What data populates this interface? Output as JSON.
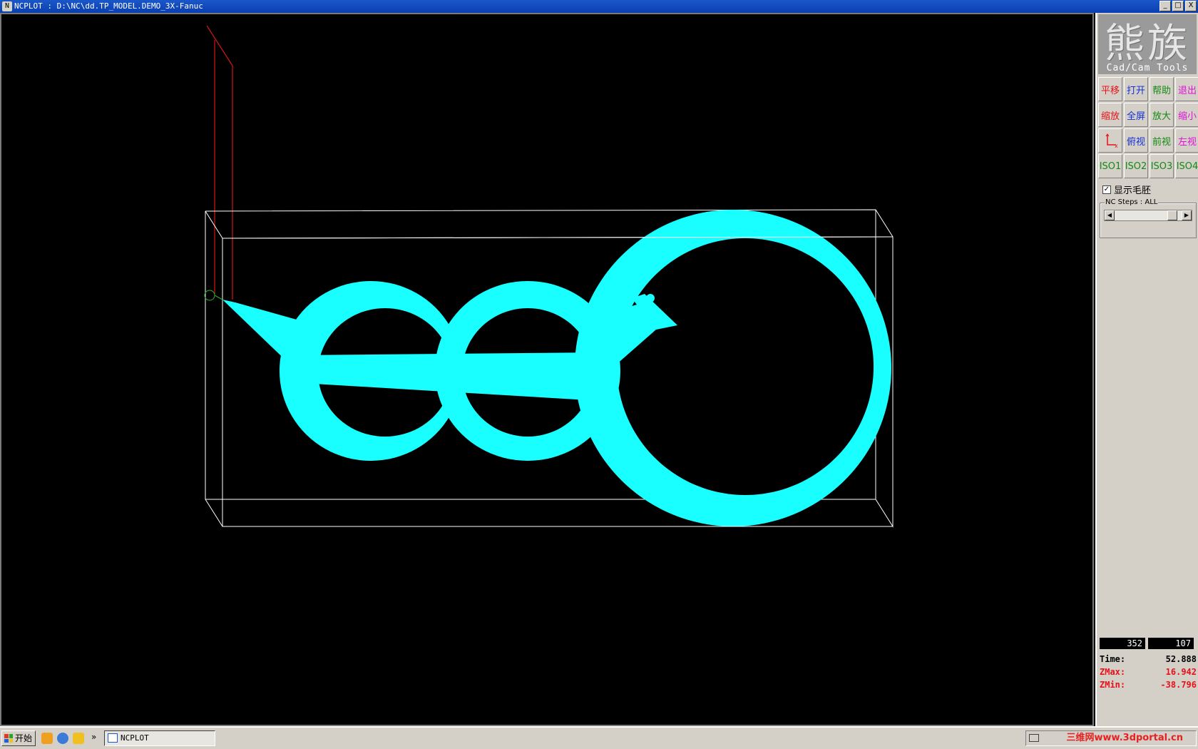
{
  "window": {
    "title": "NCPLOT : D:\\NC\\dd.TP_MODEL.DEMO_3X-Fanuc",
    "app_icon": "N",
    "controls": [
      "_",
      "□",
      "X"
    ]
  },
  "logo": {
    "chars": "熊族",
    "subtitle": "Cad/Cam Tools"
  },
  "toolbar": {
    "buttons": [
      {
        "label": "平移",
        "color": "#e8101a"
      },
      {
        "label": "打开",
        "color": "#1530d8"
      },
      {
        "label": "帮助",
        "color": "#118a11"
      },
      {
        "label": "退出",
        "color": "#e011d8"
      },
      {
        "label": "缩放",
        "color": "#e8101a"
      },
      {
        "label": "全屏",
        "color": "#1530d8"
      },
      {
        "label": "放大",
        "color": "#118a11"
      },
      {
        "label": "缩小",
        "color": "#e011d8"
      },
      {
        "label": "",
        "icon": "axis-icon",
        "color": "#e8101a"
      },
      {
        "label": "俯视",
        "color": "#1530d8"
      },
      {
        "label": "前视",
        "color": "#118a11"
      },
      {
        "label": "左视",
        "color": "#e011d8"
      },
      {
        "label": "ISO1",
        "color": "#118a11"
      },
      {
        "label": "ISO2",
        "color": "#118a11"
      },
      {
        "label": "ISO3",
        "color": "#118a11"
      },
      {
        "label": "ISO4",
        "color": "#118a11"
      }
    ]
  },
  "stock": {
    "checkbox_label": "显示毛胚",
    "checked": true
  },
  "nc_steps": {
    "label": "NC Steps : ALL",
    "position": 0.92
  },
  "readouts": {
    "x": "352",
    "y": "107"
  },
  "stats": {
    "time_label": "Time:",
    "time_value": "52.888",
    "zmax_label": "ZMax:",
    "zmax_value": "16.942",
    "zmin_label": "ZMin:",
    "zmin_value": "-38.796"
  },
  "colors": {
    "toolpath": "#19ffff",
    "stock_box": "#ffffff",
    "tool_axis": "#d01818",
    "background": "#000000"
  },
  "taskbar": {
    "start_label": "开始",
    "chevron": "»",
    "task_label": "NCPLOT",
    "tray_watermark": "三维网www.3dportal.cn"
  }
}
